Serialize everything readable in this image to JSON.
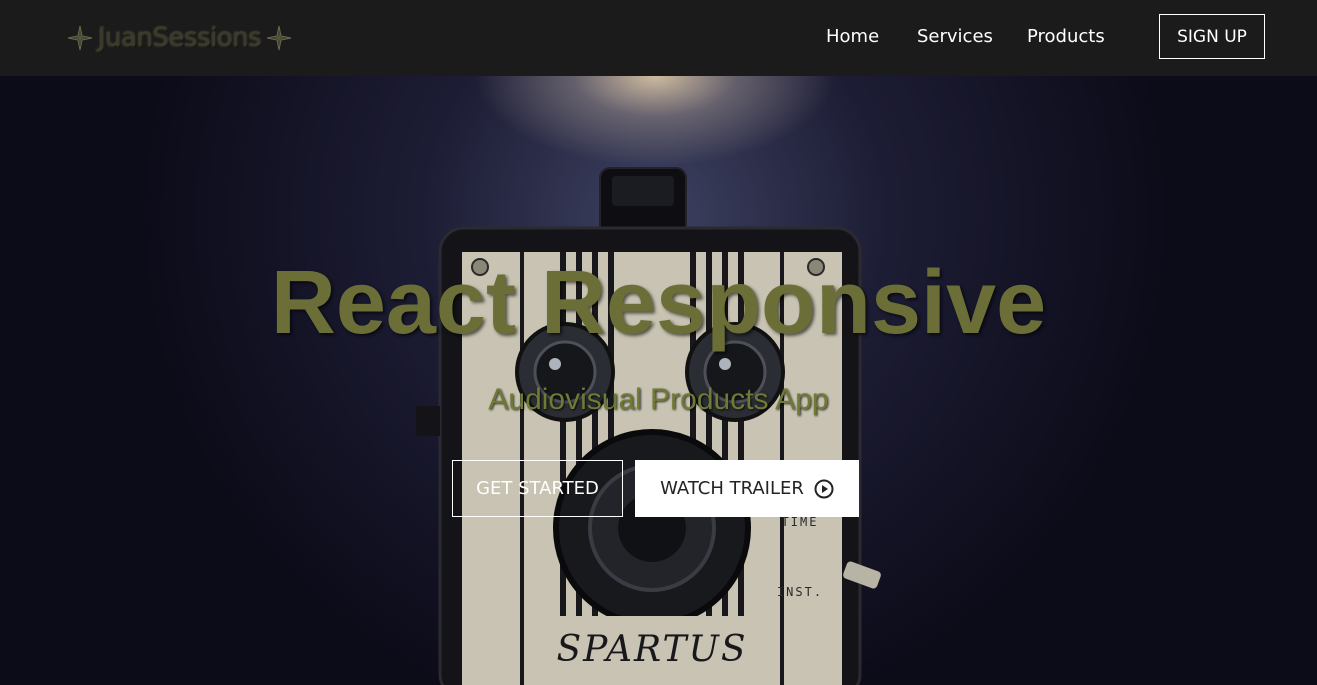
{
  "navbar": {
    "logo_text": "JuanSessions",
    "links": [
      {
        "label": "Home"
      },
      {
        "label": "Services"
      },
      {
        "label": "Products"
      }
    ],
    "signup_label": "SIGN UP"
  },
  "hero": {
    "title": "React Responsive",
    "subtitle": "Audiovisual Products App",
    "get_started_label": "GET STARTED",
    "watch_trailer_label": "WATCH TRAILER",
    "camera_brand": "SPARTUS",
    "camera_label_time": "TIME",
    "camera_label_inst": "INST."
  },
  "colors": {
    "navbar_bg": "#1c1b1b",
    "title_color": "#6b6f37",
    "subtitle_color": "#6f7a36",
    "button_white": "#ffffff"
  },
  "icons": {
    "logo_ornament": "ornament-star-icon",
    "trailer": "play-circle-icon"
  }
}
